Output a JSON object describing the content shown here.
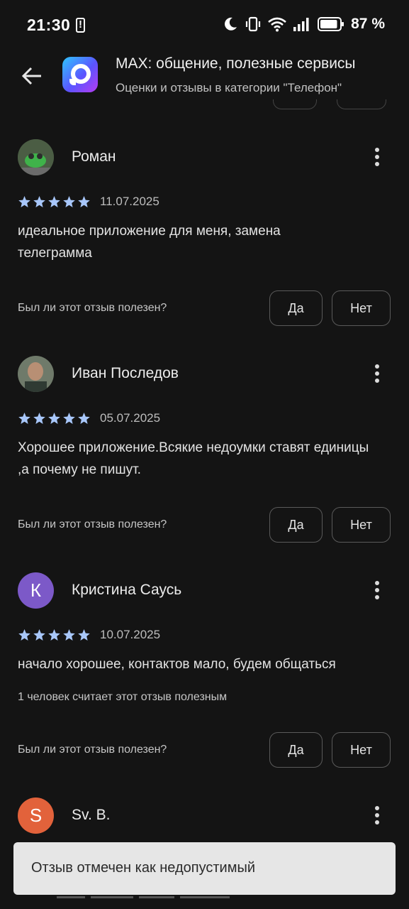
{
  "status_bar": {
    "time": "21:30",
    "battery": "87 %",
    "icons": [
      "alert-icon",
      "moon-icon",
      "vibrate-icon",
      "wifi-icon",
      "signal-icon",
      "battery-icon"
    ]
  },
  "header": {
    "title": "MAX: общение, полезные сервисы",
    "subtitle": "Оценки и отзывы в категории \"Телефон\"",
    "accent_gradient": [
      "#2ec6ff",
      "#5b54ff",
      "#b63cf2"
    ]
  },
  "colors": {
    "star": "#a8c7fa",
    "background": "#141414",
    "avatar_k": "#7c59c8",
    "avatar_s": "#e2623b"
  },
  "reviews": [
    {
      "name": "Роман",
      "rating": 5,
      "date": "11.07.2025",
      "text": "идеальное приложение для меня, замена телеграмма",
      "helpful_question": "Был ли этот отзыв полезен?",
      "yes": "Да",
      "no": "Нет"
    },
    {
      "name": "Иван Последов",
      "rating": 5,
      "date": "05.07.2025",
      "text": "Хорошее приложение.Всякие недоумки ставят единицы ,а почему не пишут.",
      "helpful_question": "Был ли этот отзыв полезен?",
      "yes": "Да",
      "no": "Нет"
    },
    {
      "name": "Кристина Саусь",
      "avatar_letter": "К",
      "rating": 5,
      "date": "10.07.2025",
      "text": "начало хорошее, контактов мало, будем общаться",
      "helpful_count": "1 человек считает этот отзыв полезным",
      "helpful_question": "Был ли этот отзыв полезен?",
      "yes": "Да",
      "no": "Нет"
    },
    {
      "name": "Sv. B.",
      "avatar_letter": "S"
    }
  ],
  "snackbar": {
    "text": "Отзыв отмечен как недопустимый"
  }
}
